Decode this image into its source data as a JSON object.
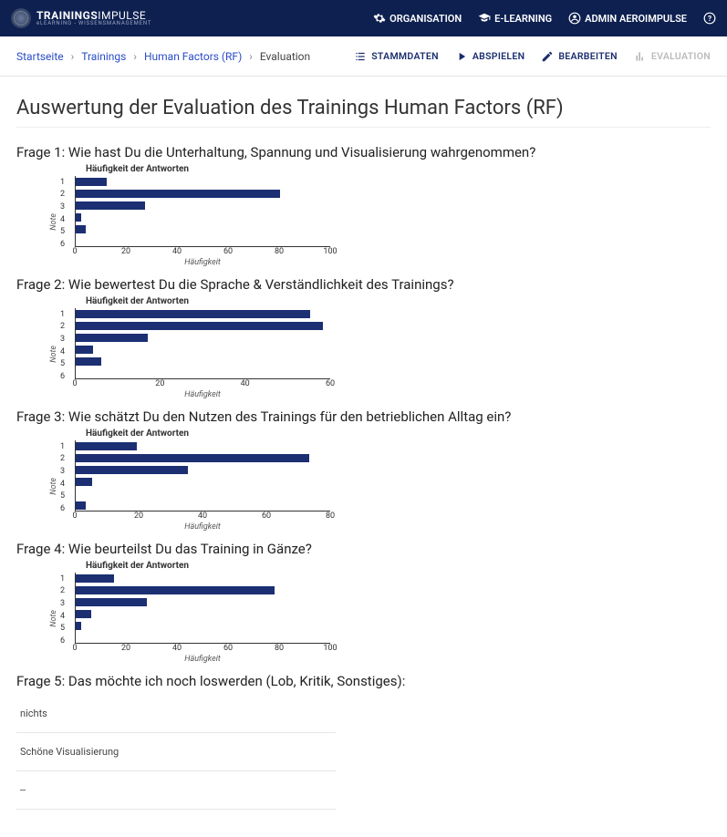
{
  "header": {
    "logo_line1_a": "TRAININGS",
    "logo_line1_b": "IMPULSE",
    "logo_line2": "eLEARNING - WISSENSMANAGEMENT",
    "nav": {
      "organisation": "ORGANISATION",
      "elearning": "E-LEARNING",
      "admin": "ADMIN AEROIMPULSE"
    }
  },
  "breadcrumb": {
    "items": [
      "Startseite",
      "Trainings",
      "Human Factors (RF)",
      "Evaluation"
    ]
  },
  "actions": {
    "stammdaten": "STAMMDATEN",
    "abspielen": "ABSPIELEN",
    "bearbeiten": "BEARBEITEN",
    "evaluation": "EVALUATION"
  },
  "page_title": "Auswertung der Evaluation des Trainings Human Factors (RF)",
  "chart_common": {
    "title": "Häufigkeit der Antworten",
    "ylabel": "Note",
    "xlabel": "Häufigkeit",
    "categories": [
      "1",
      "2",
      "3",
      "4",
      "5",
      "6"
    ]
  },
  "questions": [
    {
      "label": "Frage 1: Wie hast Du die Unterhaltung, Spannung und Visualisierung wahrgenommen?"
    },
    {
      "label": "Frage 2: Wie bewertest Du die Sprache & Verständlichkeit des Trainings?"
    },
    {
      "label": "Frage 3: Wie schätzt Du den Nutzen des Trainings für den betrieblichen Alltag ein?"
    },
    {
      "label": "Frage 4: Wie beurteilst Du das Training in Gänze?"
    },
    {
      "label": "Frage 5: Das möchte ich noch loswerden (Lob, Kritik, Sonstiges):"
    }
  ],
  "chart_data": [
    {
      "type": "bar",
      "categories": [
        "1",
        "2",
        "3",
        "4",
        "5",
        "6"
      ],
      "values": [
        12,
        80,
        27,
        2,
        4,
        0
      ],
      "xticks": [
        0,
        20,
        40,
        60,
        80,
        100
      ],
      "xmax": 100,
      "title": "Häufigkeit der Antworten",
      "xlabel": "Häufigkeit",
      "ylabel": "Note"
    },
    {
      "type": "bar",
      "categories": [
        "1",
        "2",
        "3",
        "4",
        "5",
        "6"
      ],
      "values": [
        55,
        58,
        17,
        4,
        6,
        0
      ],
      "xticks": [
        0,
        20,
        40,
        60
      ],
      "xmax": 60,
      "title": "Häufigkeit der Antworten",
      "xlabel": "Häufigkeit",
      "ylabel": "Note"
    },
    {
      "type": "bar",
      "categories": [
        "1",
        "2",
        "3",
        "4",
        "5",
        "6"
      ],
      "values": [
        19,
        73,
        35,
        5,
        0,
        3
      ],
      "xticks": [
        0,
        20,
        40,
        60,
        80
      ],
      "xmax": 80,
      "title": "Häufigkeit der Antworten",
      "xlabel": "Häufigkeit",
      "ylabel": "Note"
    },
    {
      "type": "bar",
      "categories": [
        "1",
        "2",
        "3",
        "4",
        "5",
        "6"
      ],
      "values": [
        15,
        78,
        28,
        6,
        2,
        0
      ],
      "xticks": [
        0,
        20,
        40,
        60,
        80,
        100
      ],
      "xmax": 100,
      "title": "Häufigkeit der Antworten",
      "xlabel": "Häufigkeit",
      "ylabel": "Note"
    }
  ],
  "comments": [
    "nichts",
    "Schöne Visualisierung",
    "--"
  ]
}
